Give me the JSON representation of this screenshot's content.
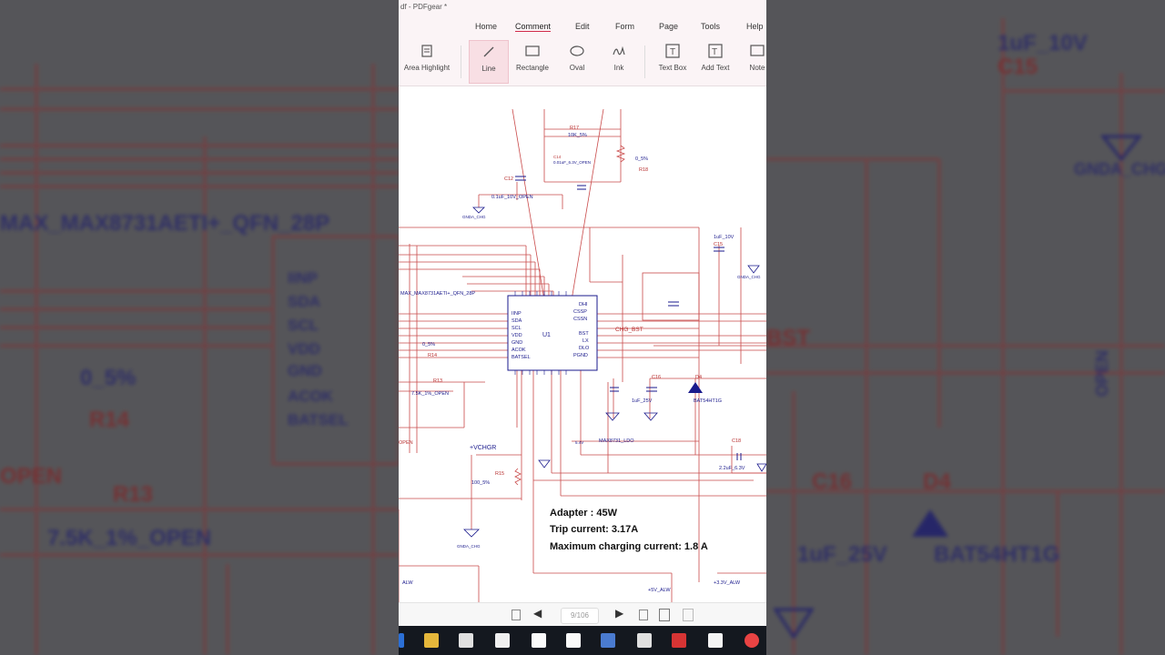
{
  "titlebar": {
    "text": "df - PDFgear *"
  },
  "menu": {
    "items": [
      {
        "label": "Home"
      },
      {
        "label": "Comment"
      },
      {
        "label": "Edit"
      },
      {
        "label": "Form"
      },
      {
        "label": "Page"
      },
      {
        "label": "Tools"
      },
      {
        "label": "Help"
      }
    ],
    "active": "Comment"
  },
  "ribbon": {
    "tools": [
      {
        "label": "Area Highlight",
        "icon": "area-highlight-icon"
      },
      {
        "label": "Line",
        "icon": "line-icon"
      },
      {
        "label": "Rectangle",
        "icon": "rectangle-icon"
      },
      {
        "label": "Oval",
        "icon": "oval-icon"
      },
      {
        "label": "Ink",
        "icon": "ink-icon"
      },
      {
        "label": "Text Box",
        "icon": "text-box-icon"
      },
      {
        "label": "Add Text",
        "icon": "add-text-icon"
      },
      {
        "label": "Note",
        "icon": "note-icon"
      }
    ],
    "active": "Line"
  },
  "schematic": {
    "chip_label": "MAX_MAX8731AETI+_QFN_28P",
    "u1": "U1",
    "pins_left": [
      "IINP",
      "SDA",
      "SCL",
      "VDD",
      "GND",
      "ACOK",
      "BATSEL"
    ],
    "pins_right": [
      "DHI",
      "CSSP",
      "CSSN",
      "BST",
      "LX",
      "DLO",
      "PGND"
    ],
    "labels": {
      "r17": "R17",
      "r17v": "10K_5%",
      "c14": "C14",
      "c14v": "0.01uF_6.3V_OPEN",
      "r18v": "0_5%",
      "r18": "R18",
      "c12": "C12",
      "c12v": "0.1uF_10V_OPEN",
      "gnda1": "GNDA_CHG",
      "c15v": "1uF_10V",
      "c15": "C15",
      "chg_bst": "CHG_BST",
      "r14v": "0_5%",
      "r14": "R14",
      "r13": "R13",
      "r13v": "7.5K_1%_OPEN",
      "c16": "C16",
      "c16v": "1uF_25V",
      "d4": "D4",
      "d4v": "BAT54HT1G",
      "ldo": "MAX8731_LDO",
      "ldov": "5.4V",
      "vchgr": "+VCHGR",
      "r15": "R15",
      "r15v": "100_5%",
      "c18": "C18",
      "c18v": "2.2uF_6.3V",
      "gnda2": "GNDA_CHG",
      "alw1": "ALW",
      "alw2": "+5V_ALW",
      "alw3": "+3.3V_ALW",
      "open": "OPEN"
    }
  },
  "notes": {
    "adapter": "Adapter : 45W",
    "trip": "Trip current: 3.17A",
    "max_charge": "Maximum charging current: 1.8 A"
  },
  "navbar": {
    "page": "9/106"
  },
  "side_text": {
    "chip": "MAX_MAX8731AETI+_QFN_28P",
    "pins": [
      "IINP",
      "SDA",
      "SCL",
      "VDD",
      "GND",
      "ACOK",
      "BATSEL"
    ],
    "r14v": "0_5%",
    "r14": "R14",
    "r13": "R13",
    "r13v": "7.5K_1%_OPEN",
    "open": "OPEN",
    "c15v": "1uF_10V",
    "c15": "C15",
    "gnda": "GNDA_CHG",
    "c16": "C16",
    "d4": "D4",
    "c16v": "1uF_25V",
    "d4v": "BAT54HT1G",
    "bst": "BST",
    "open2": "OPEN"
  },
  "colors": {
    "wire": "#c0392b",
    "label": "#1a1a8c",
    "accent": "#d02a4a"
  }
}
